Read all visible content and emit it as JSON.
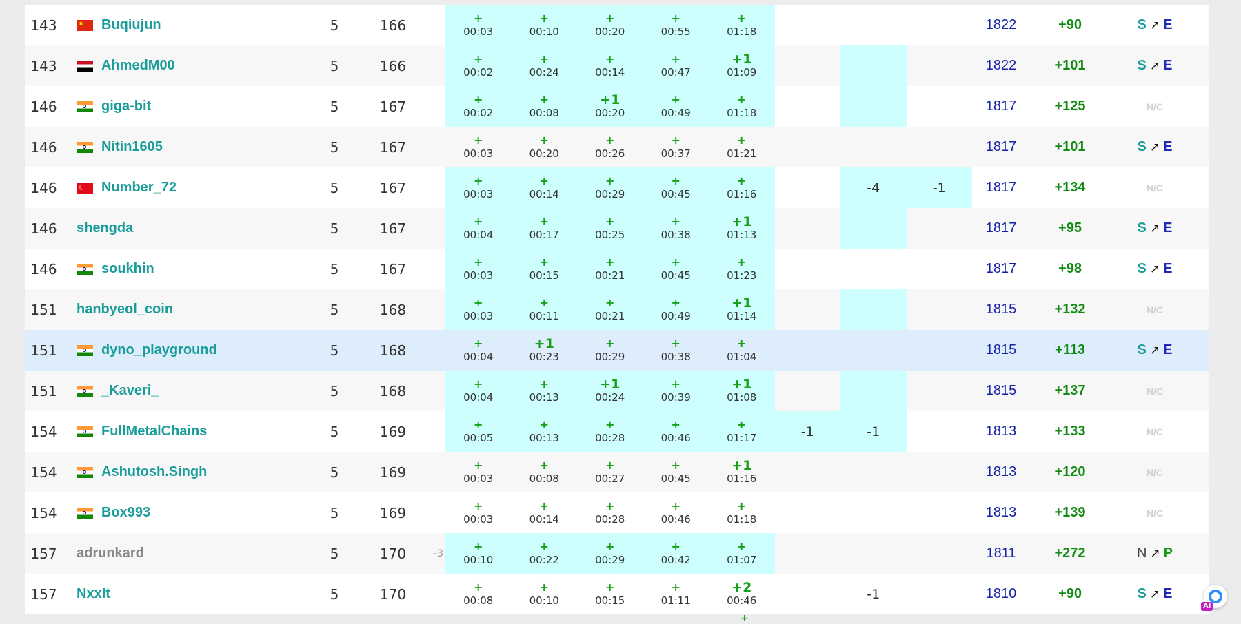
{
  "problem_columns": 8,
  "rows": [
    {
      "rank": "143",
      "flag": "cn",
      "handle": "Buqiujun",
      "solved": "5",
      "penalty": "166",
      "delta": "",
      "problems": [
        {
          "acc": true,
          "mark": "+",
          "time": "00:03"
        },
        {
          "acc": true,
          "mark": "+",
          "time": "00:10"
        },
        {
          "acc": true,
          "mark": "+",
          "time": "00:20"
        },
        {
          "acc": true,
          "mark": "+",
          "time": "00:55"
        },
        {
          "acc": true,
          "mark": "+",
          "time": "01:18"
        },
        {
          "acc": false,
          "neg": ""
        },
        {
          "acc": false,
          "neg": ""
        },
        {
          "acc": false,
          "neg": ""
        }
      ],
      "rating": "1822",
      "diff": "+90",
      "trans_a": "S",
      "trans_b": "E",
      "nc": false
    },
    {
      "rank": "143",
      "flag": "eg",
      "handle": "AhmedM00",
      "solved": "5",
      "penalty": "166",
      "delta": "",
      "problems": [
        {
          "acc": true,
          "mark": "+",
          "time": "00:02"
        },
        {
          "acc": true,
          "mark": "+",
          "time": "00:24"
        },
        {
          "acc": true,
          "mark": "+",
          "time": "00:14"
        },
        {
          "acc": true,
          "mark": "+",
          "time": "00:47"
        },
        {
          "acc": true,
          "mark": "+1",
          "time": "01:09"
        },
        {
          "acc": false,
          "neg": ""
        },
        {
          "acc": true,
          "neg": ""
        },
        {
          "acc": false,
          "neg": ""
        }
      ],
      "rating": "1822",
      "diff": "+101",
      "trans_a": "S",
      "trans_b": "E",
      "nc": false
    },
    {
      "rank": "146",
      "flag": "in",
      "handle": "giga-bit",
      "solved": "5",
      "penalty": "167",
      "delta": "",
      "problems": [
        {
          "acc": true,
          "mark": "+",
          "time": "00:02"
        },
        {
          "acc": true,
          "mark": "+",
          "time": "00:08"
        },
        {
          "acc": true,
          "mark": "+1",
          "time": "00:20"
        },
        {
          "acc": true,
          "mark": "+",
          "time": "00:49"
        },
        {
          "acc": true,
          "mark": "+",
          "time": "01:18"
        },
        {
          "acc": false,
          "neg": ""
        },
        {
          "acc": true,
          "neg": ""
        },
        {
          "acc": false,
          "neg": ""
        }
      ],
      "rating": "1817",
      "diff": "+125",
      "nc": true
    },
    {
      "rank": "146",
      "flag": "in",
      "handle": "Nitin1605",
      "solved": "5",
      "penalty": "167",
      "delta": "",
      "problems": [
        {
          "acc": false,
          "mark": "+",
          "time": "00:03"
        },
        {
          "acc": false,
          "mark": "+",
          "time": "00:20"
        },
        {
          "acc": false,
          "mark": "+",
          "time": "00:26"
        },
        {
          "acc": false,
          "mark": "+",
          "time": "00:37"
        },
        {
          "acc": false,
          "mark": "+",
          "time": "01:21"
        },
        {
          "acc": false,
          "neg": ""
        },
        {
          "acc": false,
          "neg": ""
        },
        {
          "acc": false,
          "neg": ""
        }
      ],
      "rating": "1817",
      "diff": "+101",
      "trans_a": "S",
      "trans_b": "E",
      "nc": false
    },
    {
      "rank": "146",
      "flag": "tr",
      "handle": "Number_72",
      "solved": "5",
      "penalty": "167",
      "delta": "",
      "problems": [
        {
          "acc": true,
          "mark": "+",
          "time": "00:03"
        },
        {
          "acc": true,
          "mark": "+",
          "time": "00:14"
        },
        {
          "acc": true,
          "mark": "+",
          "time": "00:29"
        },
        {
          "acc": true,
          "mark": "+",
          "time": "00:45"
        },
        {
          "acc": true,
          "mark": "+",
          "time": "01:16"
        },
        {
          "acc": false,
          "neg": ""
        },
        {
          "acc": true,
          "neg": "-4"
        },
        {
          "acc": true,
          "neg": "-1"
        }
      ],
      "rating": "1817",
      "diff": "+134",
      "nc": true
    },
    {
      "rank": "146",
      "flag": "",
      "handle": "shengda",
      "solved": "5",
      "penalty": "167",
      "delta": "",
      "problems": [
        {
          "acc": true,
          "mark": "+",
          "time": "00:04"
        },
        {
          "acc": true,
          "mark": "+",
          "time": "00:17"
        },
        {
          "acc": true,
          "mark": "+",
          "time": "00:25"
        },
        {
          "acc": true,
          "mark": "+",
          "time": "00:38"
        },
        {
          "acc": true,
          "mark": "+1",
          "time": "01:13"
        },
        {
          "acc": false,
          "neg": ""
        },
        {
          "acc": true,
          "neg": ""
        },
        {
          "acc": false,
          "neg": ""
        }
      ],
      "rating": "1817",
      "diff": "+95",
      "trans_a": "S",
      "trans_b": "E",
      "nc": false
    },
    {
      "rank": "146",
      "flag": "in",
      "handle": "soukhin",
      "solved": "5",
      "penalty": "167",
      "delta": "",
      "problems": [
        {
          "acc": true,
          "mark": "+",
          "time": "00:03"
        },
        {
          "acc": true,
          "mark": "+",
          "time": "00:15"
        },
        {
          "acc": true,
          "mark": "+",
          "time": "00:21"
        },
        {
          "acc": true,
          "mark": "+",
          "time": "00:45"
        },
        {
          "acc": true,
          "mark": "+",
          "time": "01:23"
        },
        {
          "acc": false,
          "neg": ""
        },
        {
          "acc": false,
          "neg": ""
        },
        {
          "acc": false,
          "neg": ""
        }
      ],
      "rating": "1817",
      "diff": "+98",
      "trans_a": "S",
      "trans_b": "E",
      "nc": false
    },
    {
      "rank": "151",
      "flag": "",
      "handle": "hanbyeol_coin",
      "solved": "5",
      "penalty": "168",
      "delta": "",
      "problems": [
        {
          "acc": true,
          "mark": "+",
          "time": "00:03"
        },
        {
          "acc": true,
          "mark": "+",
          "time": "00:11"
        },
        {
          "acc": true,
          "mark": "+",
          "time": "00:21"
        },
        {
          "acc": true,
          "mark": "+",
          "time": "00:49"
        },
        {
          "acc": true,
          "mark": "+1",
          "time": "01:14"
        },
        {
          "acc": false,
          "neg": ""
        },
        {
          "acc": true,
          "neg": ""
        },
        {
          "acc": false,
          "neg": ""
        }
      ],
      "rating": "1815",
      "diff": "+132",
      "nc": true
    },
    {
      "rank": "151",
      "flag": "in",
      "handle": "dyno_playground",
      "solved": "5",
      "penalty": "168",
      "delta": "",
      "highlight": true,
      "problems": [
        {
          "acc": false,
          "mark": "+",
          "time": "00:04"
        },
        {
          "acc": false,
          "mark": "+1",
          "time": "00:23"
        },
        {
          "acc": false,
          "mark": "+",
          "time": "00:29"
        },
        {
          "acc": false,
          "mark": "+",
          "time": "00:38"
        },
        {
          "acc": false,
          "mark": "+",
          "time": "01:04"
        },
        {
          "acc": false,
          "neg": ""
        },
        {
          "acc": false,
          "neg": ""
        },
        {
          "acc": false,
          "neg": ""
        }
      ],
      "rating": "1815",
      "diff": "+113",
      "trans_a": "S",
      "trans_b": "E",
      "nc": false
    },
    {
      "rank": "151",
      "flag": "in",
      "handle": "_Kaveri_",
      "solved": "5",
      "penalty": "168",
      "delta": "",
      "problems": [
        {
          "acc": true,
          "mark": "+",
          "time": "00:04"
        },
        {
          "acc": true,
          "mark": "+",
          "time": "00:13"
        },
        {
          "acc": true,
          "mark": "+1",
          "time": "00:24"
        },
        {
          "acc": true,
          "mark": "+",
          "time": "00:39"
        },
        {
          "acc": true,
          "mark": "+1",
          "time": "01:08"
        },
        {
          "acc": false,
          "neg": ""
        },
        {
          "acc": true,
          "neg": ""
        },
        {
          "acc": false,
          "neg": ""
        }
      ],
      "rating": "1815",
      "diff": "+137",
      "nc": true
    },
    {
      "rank": "154",
      "flag": "in",
      "handle": "FullMetalChains",
      "solved": "5",
      "penalty": "169",
      "delta": "",
      "problems": [
        {
          "acc": true,
          "mark": "+",
          "time": "00:05"
        },
        {
          "acc": true,
          "mark": "+",
          "time": "00:13"
        },
        {
          "acc": true,
          "mark": "+",
          "time": "00:28"
        },
        {
          "acc": true,
          "mark": "+",
          "time": "00:46"
        },
        {
          "acc": true,
          "mark": "+",
          "time": "01:17"
        },
        {
          "acc": true,
          "neg": "-1"
        },
        {
          "acc": true,
          "neg": "-1"
        },
        {
          "acc": false,
          "neg": ""
        }
      ],
      "rating": "1813",
      "diff": "+133",
      "nc": true
    },
    {
      "rank": "154",
      "flag": "in",
      "handle": "Ashutosh.Singh",
      "solved": "5",
      "penalty": "169",
      "delta": "",
      "problems": [
        {
          "acc": false,
          "mark": "+",
          "time": "00:03"
        },
        {
          "acc": false,
          "mark": "+",
          "time": "00:08"
        },
        {
          "acc": false,
          "mark": "+",
          "time": "00:27"
        },
        {
          "acc": false,
          "mark": "+",
          "time": "00:45"
        },
        {
          "acc": false,
          "mark": "+1",
          "time": "01:16"
        },
        {
          "acc": false,
          "neg": ""
        },
        {
          "acc": false,
          "neg": ""
        },
        {
          "acc": false,
          "neg": ""
        }
      ],
      "rating": "1813",
      "diff": "+120",
      "nc": true
    },
    {
      "rank": "154",
      "flag": "in",
      "handle": "Box993",
      "solved": "5",
      "penalty": "169",
      "delta": "",
      "problems": [
        {
          "acc": false,
          "mark": "+",
          "time": "00:03"
        },
        {
          "acc": false,
          "mark": "+",
          "time": "00:14"
        },
        {
          "acc": false,
          "mark": "+",
          "time": "00:28"
        },
        {
          "acc": false,
          "mark": "+",
          "time": "00:46"
        },
        {
          "acc": false,
          "mark": "+",
          "time": "01:18"
        },
        {
          "acc": false,
          "neg": ""
        },
        {
          "acc": false,
          "neg": ""
        },
        {
          "acc": false,
          "neg": ""
        }
      ],
      "rating": "1813",
      "diff": "+139",
      "nc": true
    },
    {
      "rank": "157",
      "flag": "",
      "handle": "adrunkard",
      "grey": true,
      "solved": "5",
      "penalty": "170",
      "delta": "-3",
      "problems": [
        {
          "acc": true,
          "mark": "+",
          "time": "00:10"
        },
        {
          "acc": true,
          "mark": "+",
          "time": "00:22"
        },
        {
          "acc": true,
          "mark": "+",
          "time": "00:29"
        },
        {
          "acc": true,
          "mark": "+",
          "time": "00:42"
        },
        {
          "acc": true,
          "mark": "+",
          "time": "01:07"
        },
        {
          "acc": false,
          "neg": ""
        },
        {
          "acc": false,
          "neg": ""
        },
        {
          "acc": false,
          "neg": ""
        }
      ],
      "rating": "1811",
      "diff": "+272",
      "trans_a": "N",
      "trans_b": "P",
      "trans_grey": true,
      "nc": false
    },
    {
      "rank": "157",
      "flag": "",
      "handle": "NxxIt",
      "solved": "5",
      "penalty": "170",
      "delta": "",
      "problems": [
        {
          "acc": false,
          "mark": "+",
          "time": "00:08"
        },
        {
          "acc": false,
          "mark": "+",
          "time": "00:10"
        },
        {
          "acc": false,
          "mark": "+",
          "time": "00:15"
        },
        {
          "acc": false,
          "mark": "+",
          "time": "01:11"
        },
        {
          "acc": false,
          "mark": "+2",
          "time": "00:46"
        },
        {
          "acc": false,
          "neg": ""
        },
        {
          "acc": false,
          "neg": "-1"
        },
        {
          "acc": false,
          "neg": ""
        }
      ],
      "rating": "1810",
      "diff": "+90",
      "trans_a": "S",
      "trans_b": "E",
      "nc": false
    }
  ],
  "nc_label": "N/C",
  "transition_arrow": "↗",
  "next_row_partial_mark": "+",
  "ai_badge_label": "AI"
}
